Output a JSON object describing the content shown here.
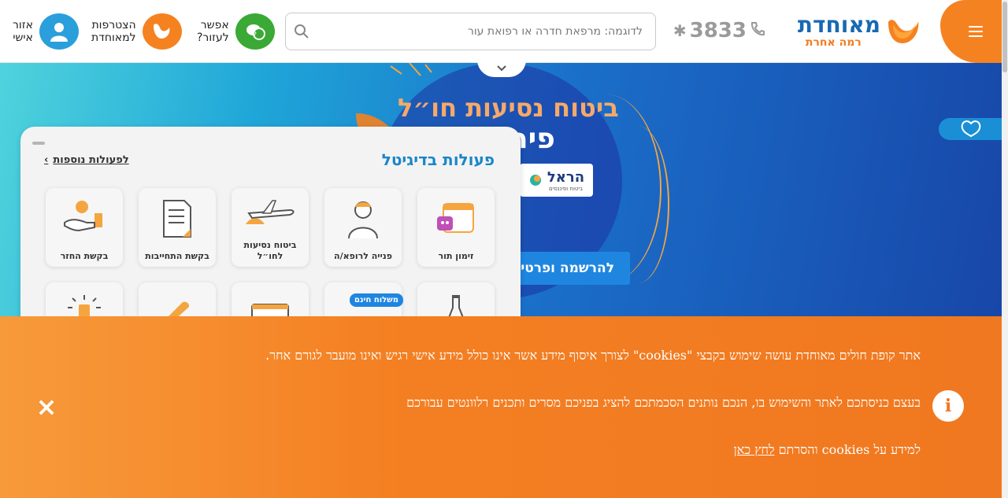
{
  "header": {
    "logo_name": "מאוחדת",
    "logo_sub": "רמה אחרת",
    "phone": "3833",
    "search_placeholder": "לדוגמה: מרפאת חדרה או רפואת עור",
    "actions": {
      "help_label_1": "אפשר",
      "help_label_2": "לעזור?",
      "join_label_1": "הצטרפות",
      "join_label_2": "למאוחדת",
      "personal_label_1": "אזור",
      "personal_label_2": "אישי"
    }
  },
  "hero": {
    "title": "ביטוח נסיעות חו״ל",
    "subtitle": "פירסט",
    "partner_name": "הראל",
    "partner_sub": "ביטוח ופיננסים",
    "cta": "להרשמה ופרטים"
  },
  "digital_panel": {
    "title": "פעולות בדיגיטל",
    "more_link": "לפעולות נוספות",
    "tiles": [
      {
        "label": "זימון תור",
        "icon": "calendar-icon"
      },
      {
        "label": "פנייה לרופא/ה",
        "icon": "doctor-icon"
      },
      {
        "label": "ביטוח נסיעות לחו״ל",
        "icon": "airplane-icon"
      },
      {
        "label": "בקשת התחייבות",
        "icon": "document-icon"
      },
      {
        "label": "בקשת החזר",
        "icon": "refund-icon"
      }
    ],
    "badge": "משלוח חינם"
  },
  "cookie_banner": {
    "line1": "אתר קופת חולים מאוחדת עושה שימוש בקבצי \"cookies\" לצורך איסוף מידע אשר אינו כולל מידע אישי רגיש ואינו מועבר לגורם אחר.",
    "line2": "בעצם כניסתכם לאתר והשימוש בו, הנכם נותנים הסכמתכם להציג בפניכם מסרים ותכנים רלוונטים עבורכם",
    "line3_prefix": "למידע על cookies והסרתם ",
    "line3_link": "לחץ כאן",
    "close_symbol": "×",
    "info_symbol": "i"
  },
  "colors": {
    "brand_orange": "#f58220",
    "brand_blue": "#1769b3",
    "help_green": "#3aa935",
    "personal_blue": "#2a9fdb"
  }
}
